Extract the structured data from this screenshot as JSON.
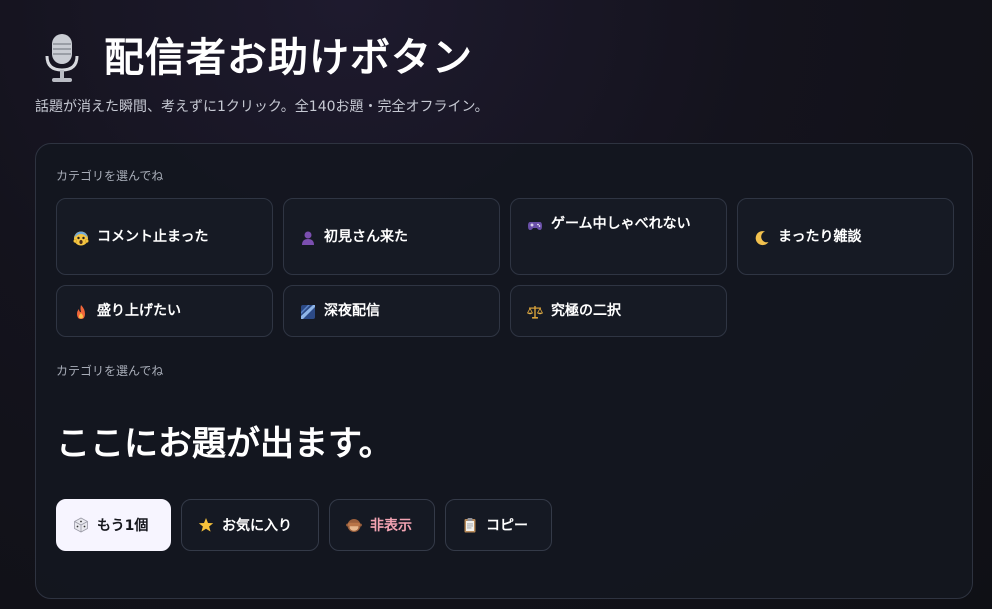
{
  "header": {
    "icon": "microphone-icon",
    "title": "配信者お助けボタン",
    "subtitle": "話題が消えた瞬間、考えずに1クリック。全140お題・完全オフライン。"
  },
  "categories": {
    "label": "カテゴリを選んでね",
    "items": [
      {
        "icon": "scream-face-icon",
        "label": "コメント止まった"
      },
      {
        "icon": "person-silhouette-icon",
        "label": "初見さん来た"
      },
      {
        "icon": "game-controller-icon",
        "label": "ゲーム中しゃべれない"
      },
      {
        "icon": "crescent-moon-icon",
        "label": "まったり雑談"
      },
      {
        "icon": "fire-icon",
        "label": "盛り上げたい"
      },
      {
        "icon": "night-sky-icon",
        "label": "深夜配信"
      },
      {
        "icon": "balance-scale-icon",
        "label": "究極の二択"
      }
    ]
  },
  "result": {
    "label": "カテゴリを選んでね",
    "topic": "ここにお題が出ます。"
  },
  "actions": [
    {
      "icon": "dice-icon",
      "label": "もう1個"
    },
    {
      "icon": "star-icon",
      "label": "お気に入り"
    },
    {
      "icon": "see-no-evil-monkey-icon",
      "label": "非表示"
    },
    {
      "icon": "clipboard-icon",
      "label": "コピー"
    }
  ],
  "colors": {
    "background": "#14131d",
    "panel": "#141720",
    "primary_button": "#f7f5ff",
    "danger_text": "#f2a3b2"
  }
}
